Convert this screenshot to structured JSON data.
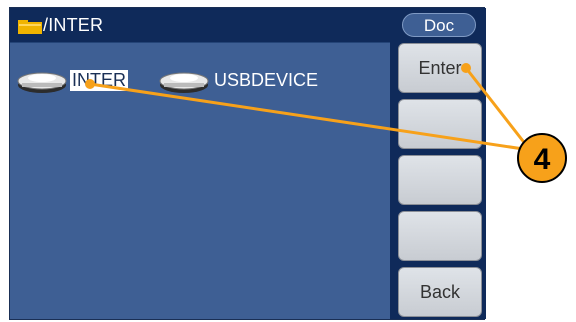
{
  "titlebar": {
    "path": "/INTER",
    "folder_icon": "folder-icon",
    "accent_color": "#f0b400"
  },
  "files": [
    {
      "label": "INTER",
      "icon": "drive-icon",
      "selected": true
    },
    {
      "label": "USBDEVICE",
      "icon": "drive-icon",
      "selected": false
    }
  ],
  "softkeys": {
    "mode_label": "Doc",
    "buttons": [
      "Enter",
      "",
      "",
      "",
      "Back"
    ]
  },
  "callout": {
    "number": "4",
    "color": "#f7a11a"
  }
}
